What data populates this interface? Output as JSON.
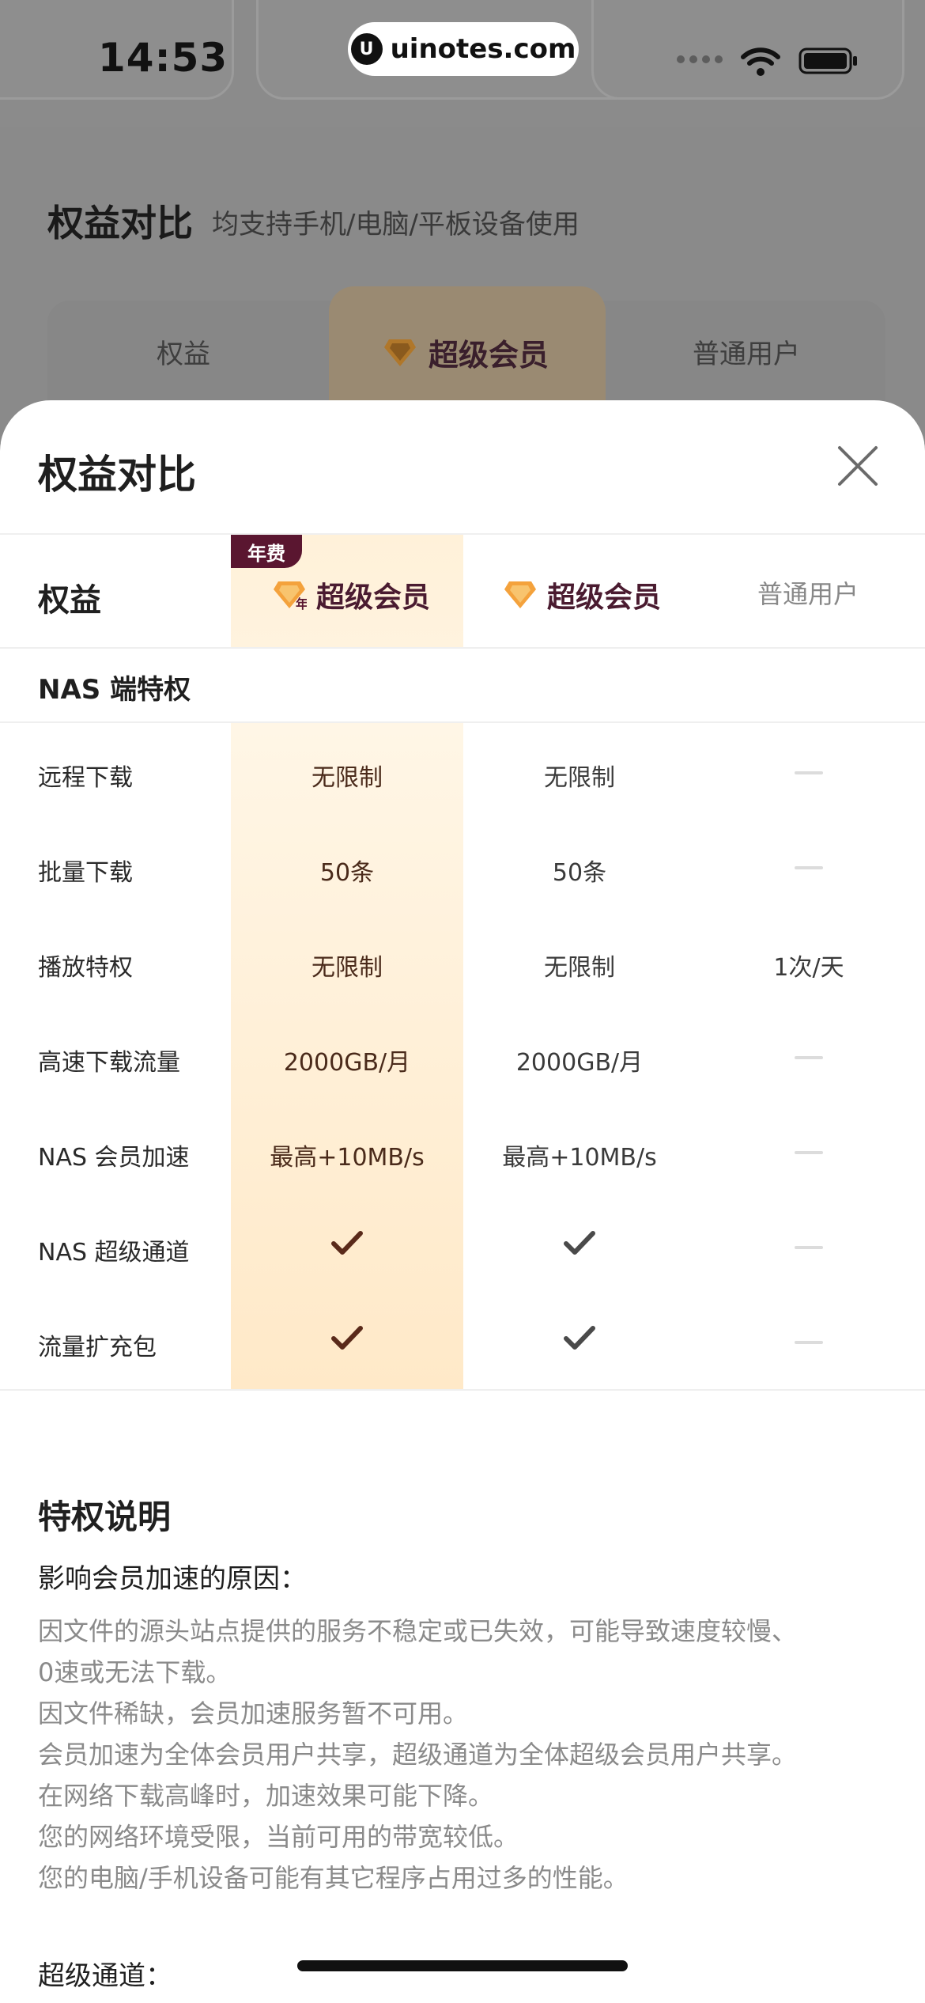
{
  "status_bar": {
    "time": "14:53",
    "url": "uinotes.com",
    "url_logo": "U"
  },
  "background_page": {
    "title": "权益对比",
    "subtitle": "均支持手机/电脑/平板设备使用",
    "tabs": [
      "权益",
      "超级会员",
      "普通用户"
    ]
  },
  "sheet": {
    "title": "权益对比",
    "header": {
      "label": "权益",
      "annual_badge": "年费",
      "annual_badge_gem": "年",
      "plans": [
        "超级会员",
        "超级会员",
        "普通用户"
      ]
    },
    "section": "NAS 端特权",
    "rows": [
      {
        "label": "远程下载",
        "values": [
          "无限制",
          "无限制",
          "-"
        ]
      },
      {
        "label": "批量下载",
        "values": [
          "50条",
          "50条",
          "-"
        ]
      },
      {
        "label": "播放特权",
        "values": [
          "无限制",
          "无限制",
          "1次/天"
        ]
      },
      {
        "label": "高速下载流量",
        "values": [
          "2000GB/月",
          "2000GB/月",
          "-"
        ]
      },
      {
        "label": "NAS 会员加速",
        "values": [
          "最高+10MB/s",
          "最高+10MB/s",
          "-"
        ]
      },
      {
        "label": "NAS 超级通道",
        "values": [
          "check",
          "check",
          "-"
        ]
      },
      {
        "label": "流量扩充包",
        "values": [
          "check",
          "check",
          "-"
        ]
      }
    ],
    "description": {
      "title": "特权说明",
      "subtitle": "影响会员加速的原因：",
      "lines": [
        "因文件的源头站点提供的服务不稳定或已失效，可能导致速度较慢、",
        "0速或无法下载。",
        "因文件稀缺，会员加速服务暂不可用。",
        "会员加速为全体会员用户共享，超级通道为全体超级会员用户共享。",
        "在网络下载高峰时，加速效果可能下降。",
        "您的网络环境受限，当前可用的带宽较低。",
        "您的电脑/手机设备可能有其它程序占用过多的性能。"
      ],
      "next_subtitle": "超级通道："
    }
  },
  "colors": {
    "accent_dark": "#5a1630",
    "highlight_column": "#fff1d9",
    "gem_orange": "#f4a23c"
  }
}
